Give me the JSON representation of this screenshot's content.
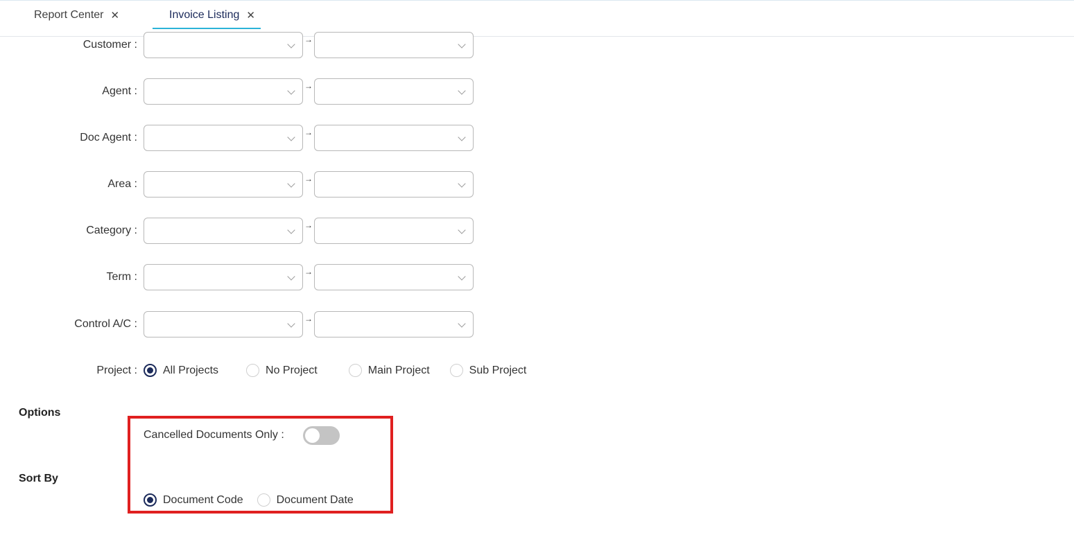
{
  "tabs": [
    {
      "label": "Report Center",
      "active": false
    },
    {
      "label": "Invoice Listing",
      "active": true
    }
  ],
  "filters": [
    {
      "label": "Customer :",
      "from": "",
      "to": ""
    },
    {
      "label": "Agent :",
      "from": "",
      "to": ""
    },
    {
      "label": "Doc Agent :",
      "from": "",
      "to": ""
    },
    {
      "label": "Area :",
      "from": "",
      "to": ""
    },
    {
      "label": "Category :",
      "from": "",
      "to": ""
    },
    {
      "label": "Term :",
      "from": "",
      "to": ""
    },
    {
      "label": "Control A/C :",
      "from": "",
      "to": ""
    }
  ],
  "range_arrow": "→",
  "project": {
    "label": "Project :",
    "options": [
      "All Projects",
      "No Project",
      "Main Project",
      "Sub Project"
    ],
    "selected": "All Projects"
  },
  "options": {
    "title": "Options",
    "cancelled_label": "Cancelled Documents Only :",
    "cancelled_value": false
  },
  "sort_by": {
    "title": "Sort By",
    "options": [
      "Document Code",
      "Document Date"
    ],
    "selected": "Document Code"
  },
  "colors": {
    "accent": "#1b2a5a",
    "tab_underline": "#2bb3d8",
    "highlight": "#e02020"
  }
}
